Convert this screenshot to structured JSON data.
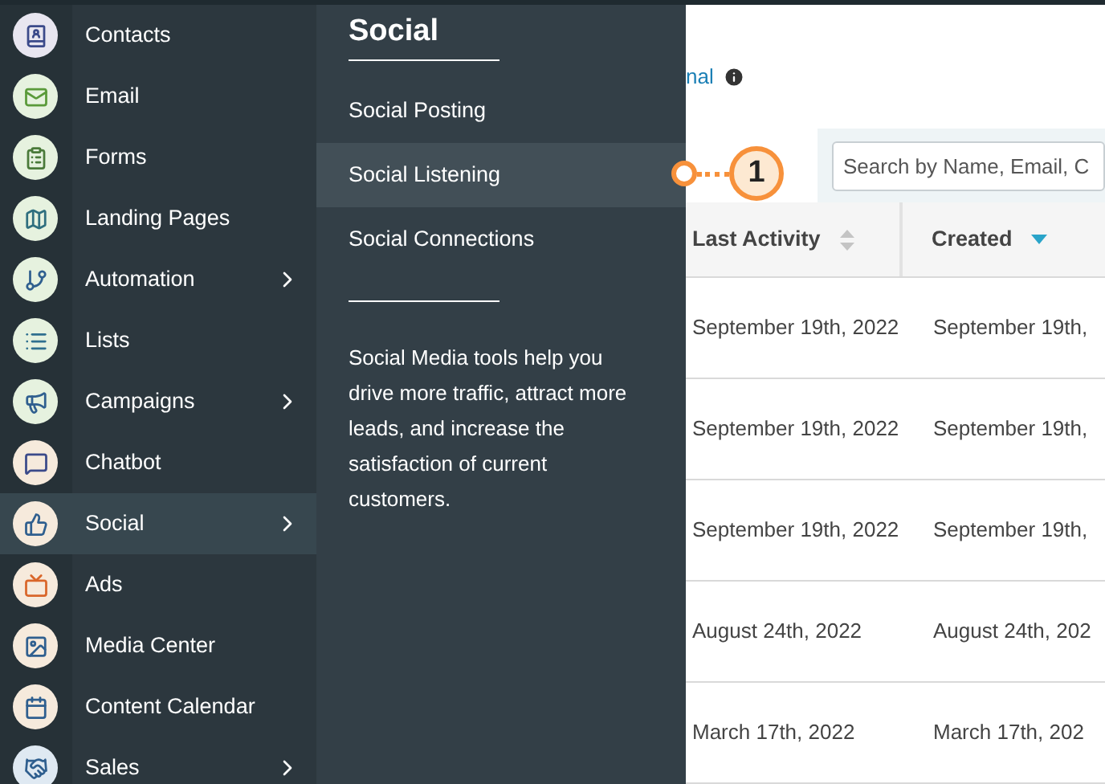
{
  "sidebar": {
    "items": [
      {
        "label": "Contacts",
        "selected": false,
        "has_submenu": false
      },
      {
        "label": "Email",
        "selected": false,
        "has_submenu": false
      },
      {
        "label": "Forms",
        "selected": false,
        "has_submenu": false
      },
      {
        "label": "Landing Pages",
        "selected": false,
        "has_submenu": false
      },
      {
        "label": "Automation",
        "selected": false,
        "has_submenu": true
      },
      {
        "label": "Lists",
        "selected": false,
        "has_submenu": false
      },
      {
        "label": "Campaigns",
        "selected": false,
        "has_submenu": true
      },
      {
        "label": "Chatbot",
        "selected": false,
        "has_submenu": false
      },
      {
        "label": "Social",
        "selected": true,
        "has_submenu": true
      },
      {
        "label": "Ads",
        "selected": false,
        "has_submenu": false
      },
      {
        "label": "Media Center",
        "selected": false,
        "has_submenu": false
      },
      {
        "label": "Content Calendar",
        "selected": false,
        "has_submenu": false
      },
      {
        "label": "Sales",
        "selected": false,
        "has_submenu": true
      }
    ]
  },
  "flyout": {
    "title": "Social",
    "items": [
      {
        "label": "Social Posting",
        "selected": false
      },
      {
        "label": "Social Listening",
        "selected": true
      },
      {
        "label": "Social Connections",
        "selected": false
      }
    ],
    "description": "Social Media tools help you drive more traffic, attract more leads, and increase the satisfaction of current customers."
  },
  "callout": {
    "number": "1"
  },
  "page": {
    "link_fragment": "nal",
    "search": {
      "placeholder": "Search by Name, Email, C"
    },
    "table": {
      "columns": [
        {
          "label": "Last Activity",
          "sorted": false
        },
        {
          "label": "Created",
          "sorted": true
        }
      ],
      "rows": [
        {
          "cells": [
            "September 19th, 2022",
            "September 19th,"
          ]
        },
        {
          "cells": [
            "September 19th, 2022",
            "September 19th,"
          ]
        },
        {
          "cells": [
            "September 19th, 2022",
            "September 19th,"
          ]
        },
        {
          "cells": [
            "August 24th, 2022",
            "August 24th, 202"
          ]
        },
        {
          "cells": [
            "March 17th, 2022",
            "March 17th, 202"
          ]
        }
      ]
    }
  }
}
